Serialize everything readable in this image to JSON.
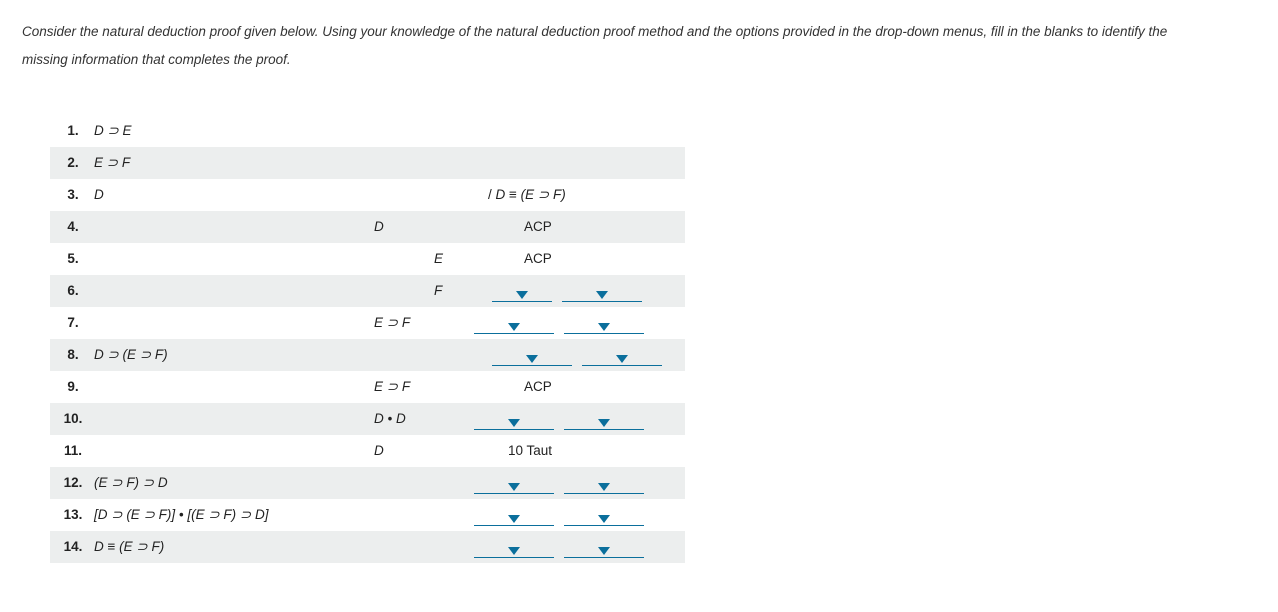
{
  "intro": "Consider the natural deduction proof given below. Using your knowledge of the natural deduction proof method and the options provided in the drop-down menus, fill in the blanks to identify the missing information that completes the proof.",
  "rows": {
    "r1": {
      "num": "1.",
      "formula": "D ⊃ E"
    },
    "r2": {
      "num": "2.",
      "formula": "E ⊃ F"
    },
    "r3": {
      "num": "3.",
      "formula": "D",
      "just": "/ D ≡ (E ⊃ F)"
    },
    "r4": {
      "num": "4.",
      "sub1": "D",
      "just": "ACP"
    },
    "r5": {
      "num": "5.",
      "sub2": "E",
      "just": "ACP"
    },
    "r6": {
      "num": "6.",
      "sub2": "F"
    },
    "r7": {
      "num": "7.",
      "sub1": "E ⊃ F"
    },
    "r8": {
      "num": "8.",
      "formula": "D ⊃ (E ⊃ F)"
    },
    "r9": {
      "num": "9.",
      "sub1": "E ⊃ F",
      "just": "ACP"
    },
    "r10": {
      "num": "10.",
      "sub1": "D • D"
    },
    "r11": {
      "num": "11.",
      "sub1": "D",
      "just": "10 Taut"
    },
    "r12": {
      "num": "12.",
      "formula": "(E ⊃ F) ⊃ D"
    },
    "r13": {
      "num": "13.",
      "formula": "[D ⊃ (E ⊃ F)] • [(E ⊃ F) ⊃ D]"
    },
    "r14": {
      "num": "14.",
      "formula": "D ≡ (E ⊃ F)"
    }
  }
}
